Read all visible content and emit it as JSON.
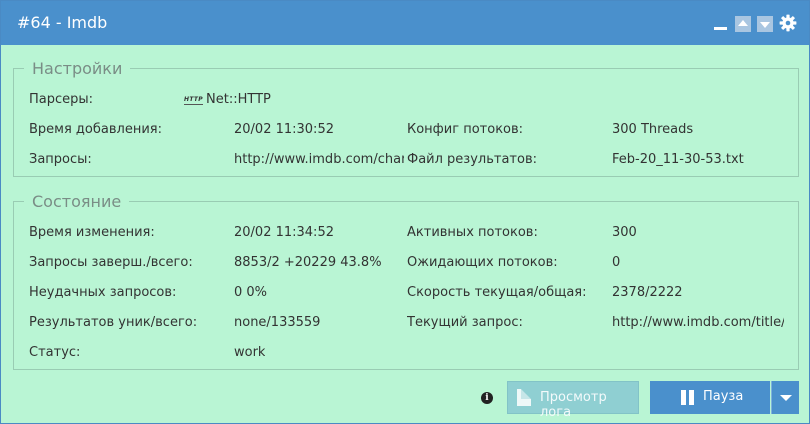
{
  "window": {
    "title": "#64 - Imdb",
    "colors": {
      "header": "#4a90cc",
      "panel_bg": "#b9f5d4",
      "border": "#99ccb3"
    },
    "controls": [
      "minimize-icon",
      "arrow-up-icon",
      "arrow-down-icon",
      "gear-icon"
    ]
  },
  "settings": {
    "legend": "Настройки",
    "parsers_label": "Парсеры:",
    "parser_icon_text": "HTTP",
    "parser_name": "Net::HTTP",
    "added_label": "Время добавления:",
    "added_value": "20/02 11:30:52",
    "threads_cfg_label": "Конфиг потоков:",
    "threads_cfg_value": "300 Threads",
    "queries_label": "Запросы:",
    "queries_value": "http://www.imdb.com/chart",
    "result_file_label": "Файл результатов:",
    "result_file_value": "Feb-20_11-30-53.txt"
  },
  "state": {
    "legend": "Состояние",
    "changed_label": "Время изменения:",
    "changed_value": "20/02 11:34:52",
    "active_threads_label": "Активных потоков:",
    "active_threads_value": "300",
    "queries_done_label": "Запросы заверш./всего:",
    "queries_done_value": "8853/2 +20229 43.8%",
    "waiting_threads_label": "Ожидающих потоков:",
    "waiting_threads_value": "0",
    "failed_label": "Неудачных запросов:",
    "failed_value": "0 0%",
    "speed_label": "Скорость текущая/общая:",
    "speed_value": "2378/2222",
    "results_label": "Результатов уник/всего:",
    "results_value": "none/133559",
    "current_query_label": "Текущий запрос:",
    "current_query_value": "http://www.imdb.com/title/tt",
    "status_label": "Статус:",
    "status_value": "work"
  },
  "footer": {
    "info_icon": "i",
    "log_button": "Просмотр лога",
    "pause_button": "Пауза"
  }
}
